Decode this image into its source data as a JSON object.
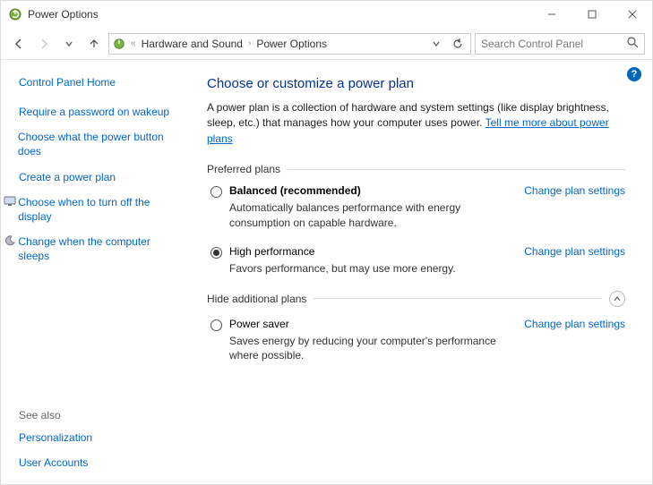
{
  "window": {
    "title": "Power Options"
  },
  "breadcrumb": {
    "parent": "Hardware and Sound",
    "current": "Power Options"
  },
  "search": {
    "placeholder": "Search Control Panel"
  },
  "sidebar": {
    "home": "Control Panel Home",
    "links": [
      "Require a password on wakeup",
      "Choose what the power button does",
      "Create a power plan",
      "Choose when to turn off the display",
      "Change when the computer sleeps"
    ],
    "see_also_header": "See also",
    "see_also": [
      "Personalization",
      "User Accounts"
    ]
  },
  "main": {
    "heading": "Choose or customize a power plan",
    "description": "A power plan is a collection of hardware and system settings (like display brightness, sleep, etc.) that manages how your computer uses power. ",
    "learn_more": "Tell me more about power plans",
    "preferred_header": "Preferred plans",
    "hide_header": "Hide additional plans",
    "change_link": "Change plan settings",
    "plans": {
      "balanced": {
        "name": "Balanced (recommended)",
        "desc": "Automatically balances performance with energy consumption on capable hardware."
      },
      "high": {
        "name": "High performance",
        "desc": "Favors performance, but may use more energy."
      },
      "saver": {
        "name": "Power saver",
        "desc": "Saves energy by reducing your computer's performance where possible."
      }
    }
  }
}
